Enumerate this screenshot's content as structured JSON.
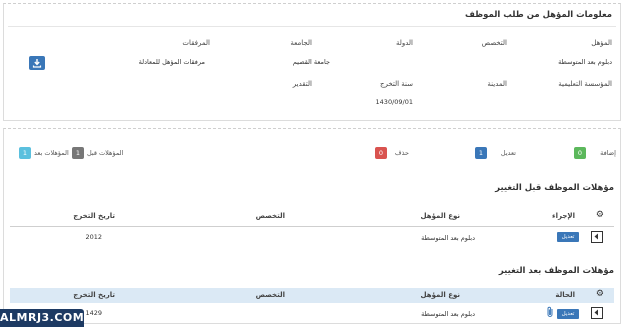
{
  "info_section": {
    "title": "معلومات المؤهل من طلب الموظف",
    "row1": {
      "labels": {
        "qualification": "المؤهل",
        "specialization": "التخصص",
        "country": "الدولة",
        "university": "الجامعة",
        "attachments": "المرفقات"
      },
      "values": {
        "qualification": "دبلوم بعد المتوسطة",
        "university": "جامعة القصيم",
        "attachments": "مرفقات المؤهل للمعادلة"
      }
    },
    "row2": {
      "labels": {
        "institution": "المؤسسة التعليمية",
        "city": "المدينة",
        "graduation_year": "سنة التخرج",
        "grade": "التقدير"
      },
      "values": {
        "graduation_year": "1430/09/01"
      }
    },
    "download_icon": "download-icon"
  },
  "legend": {
    "add": {
      "label": "إضافة",
      "count": "0"
    },
    "edit": {
      "label": "تعديل",
      "count": "1"
    },
    "delete": {
      "label": "حذف",
      "count": "0"
    },
    "before": {
      "label": "المؤهلات قبل",
      "count": "1"
    },
    "after": {
      "label": "المؤهلات بعد",
      "count": "1"
    }
  },
  "before_section": {
    "title": "مؤهلات الموظف قبل التغيير",
    "columns": {
      "action": "الإجراء",
      "type": "نوع المؤهل",
      "specialization": "التخصص",
      "graduation_date": "تاريخ التخرج"
    },
    "row": {
      "action_button": "تعديل",
      "type": "دبلوم بعد المتوسطة",
      "specialization": "",
      "graduation_date": "2012"
    }
  },
  "after_section": {
    "title": "مؤهلات الموظف بعد التغيير",
    "columns": {
      "status": "الحالة",
      "type": "نوع المؤهل",
      "specialization": "التخصص",
      "graduation_date": "تاريخ التخرج"
    },
    "row": {
      "status_button": "تعديل",
      "type": "دبلوم بعد المتوسطة",
      "specialization": "",
      "graduation_date": "1429"
    }
  },
  "watermark": "ALMRJ3.COM",
  "colors": {
    "primary": "#3a77b8",
    "success": "#5cb85c",
    "danger": "#d9534f",
    "muted": "#777777",
    "info": "#5bc0de",
    "band": "#dbe9f5"
  }
}
